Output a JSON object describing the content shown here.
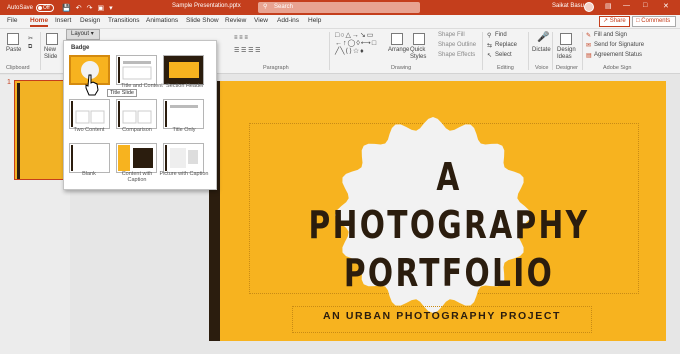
{
  "titlebar": {
    "autosave_label": "AutoSave",
    "autosave_state": "Off",
    "doc_title": "Sample Presentation.pptx",
    "search_placeholder": "Search",
    "user_name": "Saikat Basu"
  },
  "tabs": [
    "File",
    "Home",
    "Insert",
    "Design",
    "Transitions",
    "Animations",
    "Slide Show",
    "Review",
    "View",
    "Add-ins",
    "Help"
  ],
  "active_tab": "Home",
  "buttons": {
    "share": "Share",
    "comments": "Comments"
  },
  "ribbon": {
    "groups": [
      "Clipboard",
      "Paragraph",
      "Drawing",
      "Editing",
      "Voice",
      "Designer",
      "Adobe Sign"
    ],
    "paste": "Paste",
    "new_slide": "New Slide",
    "layout": "Layout",
    "arrange": "Arrange",
    "quick_styles": "Quick Styles",
    "shape_fill": "Shape Fill",
    "shape_outline": "Shape Outline",
    "shape_effects": "Shape Effects",
    "find": "Find",
    "replace": "Replace",
    "select": "Select",
    "dictate": "Dictate",
    "design_ideas": "Design Ideas",
    "fill_and_sign": "Fill and Sign",
    "send_for_signature": "Send for Signature",
    "agreement_status": "Agreement Status"
  },
  "layout_gallery": {
    "header": "Badge",
    "tooltip": "Title Slide",
    "items": [
      "Title Slide",
      "Title and Content",
      "Section Header",
      "Two Content",
      "Comparison",
      "Title Only",
      "Blank",
      "Content with Caption",
      "Picture with Caption"
    ]
  },
  "thumbnails": {
    "slide_number": "1"
  },
  "slide": {
    "title_line1": "A PHOTOGRAPHY",
    "title_line2": "PORTFOLIO",
    "subtitle": "AN URBAN PHOTOGRAPHY PROJECT"
  },
  "colors": {
    "brand": "#c43e1c",
    "slide_bg": "#f7b31f",
    "slide_dark": "#2b1d0e",
    "badge": "#f2f2f2"
  }
}
